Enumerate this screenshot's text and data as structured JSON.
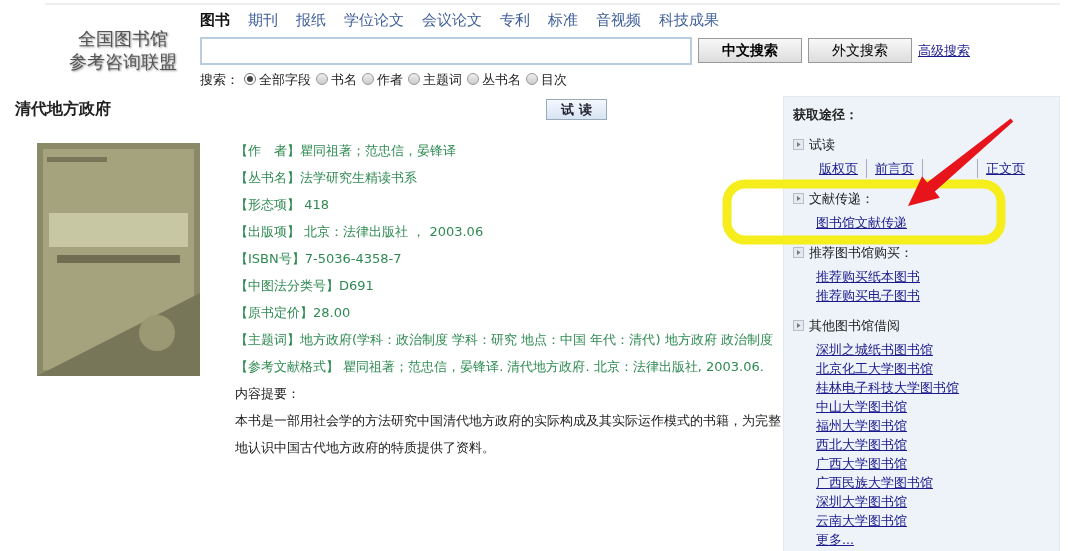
{
  "logo": {
    "lines": [
      "全国图书馆",
      "参考咨询联盟"
    ]
  },
  "category_tabs": [
    {
      "label": "图书",
      "selected": true
    },
    {
      "label": "期刊",
      "selected": false
    },
    {
      "label": "报纸",
      "selected": false
    },
    {
      "label": "学位论文",
      "selected": false
    },
    {
      "label": "会议论文",
      "selected": false
    },
    {
      "label": "专利",
      "selected": false
    },
    {
      "label": "标准",
      "selected": false
    },
    {
      "label": "音视频",
      "selected": false
    },
    {
      "label": "科技成果",
      "selected": false
    }
  ],
  "search": {
    "buttons": [
      {
        "label": "中文搜索",
        "kind": "primary"
      },
      {
        "label": "外文搜索",
        "kind": "secondary"
      }
    ],
    "advanced_link": "高级搜索",
    "scope_label": "搜索：",
    "scopes": [
      {
        "label": "全部字段",
        "selected": true
      },
      {
        "label": "书名",
        "selected": false
      },
      {
        "label": "作者",
        "selected": false
      },
      {
        "label": "主题词",
        "selected": false
      },
      {
        "label": "丛书名",
        "selected": false
      },
      {
        "label": "目次",
        "selected": false
      }
    ]
  },
  "book": {
    "title": "清代地方政府",
    "trial_button": "试 读",
    "fields": [
      "【作　者】瞿同祖著；范忠信，晏锋译",
      "【丛书名】法学研究生精读书系",
      "【形态项】 418",
      "【出版项】 北京：法律出版社 ， 2003.06",
      "【ISBN号】7-5036-4358-7",
      "【中图法分类号】D691",
      "【原书定价】28.00",
      "【主题词】地方政府(学科：政治制度 学科：研究 地点：中国 年代：清代) 地方政府 政治制度",
      "【参考文献格式】 瞿同祖著；范忠信，晏锋译. 清代地方政府. 北京：法律出版社, 2003.06."
    ],
    "summary_label": "内容提要：",
    "summary": "本书是一部用社会学的方法研究中国清代地方政府的实际构成及其实际运作模式的书籍，为完整地认识中国古代地方政府的特质提供了资料。"
  },
  "sidebar": {
    "title": "获取途径：",
    "sections": [
      {
        "heading": "试读",
        "kind": "inline",
        "links": [
          {
            "kind": "link",
            "text": "版权页"
          },
          {
            "kind": "link",
            "text": "前言页"
          },
          {
            "kind": "covered"
          },
          {
            "kind": "link",
            "text": "正文页"
          }
        ]
      },
      {
        "heading": "文献传递：",
        "kind": "list",
        "links": [
          {
            "kind": "link",
            "text": "图书馆文献传递"
          }
        ]
      },
      {
        "heading": "推荐图书馆购买：",
        "kind": "list",
        "links": [
          {
            "kind": "link",
            "text": "推荐购买纸本图书"
          },
          {
            "kind": "link",
            "text": "推荐购买电子图书"
          }
        ]
      },
      {
        "heading": "其他图书馆借阅",
        "kind": "list",
        "links": [
          {
            "kind": "link",
            "text": "深圳之城纸书图书馆"
          },
          {
            "kind": "link",
            "text": "北京化工大学图书馆"
          },
          {
            "kind": "link",
            "text": "桂林电子科技大学图书馆"
          },
          {
            "kind": "link",
            "text": "中山大学图书馆"
          },
          {
            "kind": "link",
            "text": "福州大学图书馆"
          },
          {
            "kind": "link",
            "text": "西北大学图书馆"
          },
          {
            "kind": "link",
            "text": "广西大学图书馆"
          },
          {
            "kind": "link",
            "text": "广西民族大学图书馆"
          },
          {
            "kind": "link",
            "text": "深圳大学图书馆"
          },
          {
            "kind": "link",
            "text": "云南大学图书馆"
          },
          {
            "kind": "link",
            "text": "更多..."
          }
        ]
      }
    ]
  },
  "annotations": [
    {
      "kind": "highlight",
      "color": "#f5ee1c"
    },
    {
      "kind": "arrow",
      "color": "#e8141c"
    }
  ]
}
